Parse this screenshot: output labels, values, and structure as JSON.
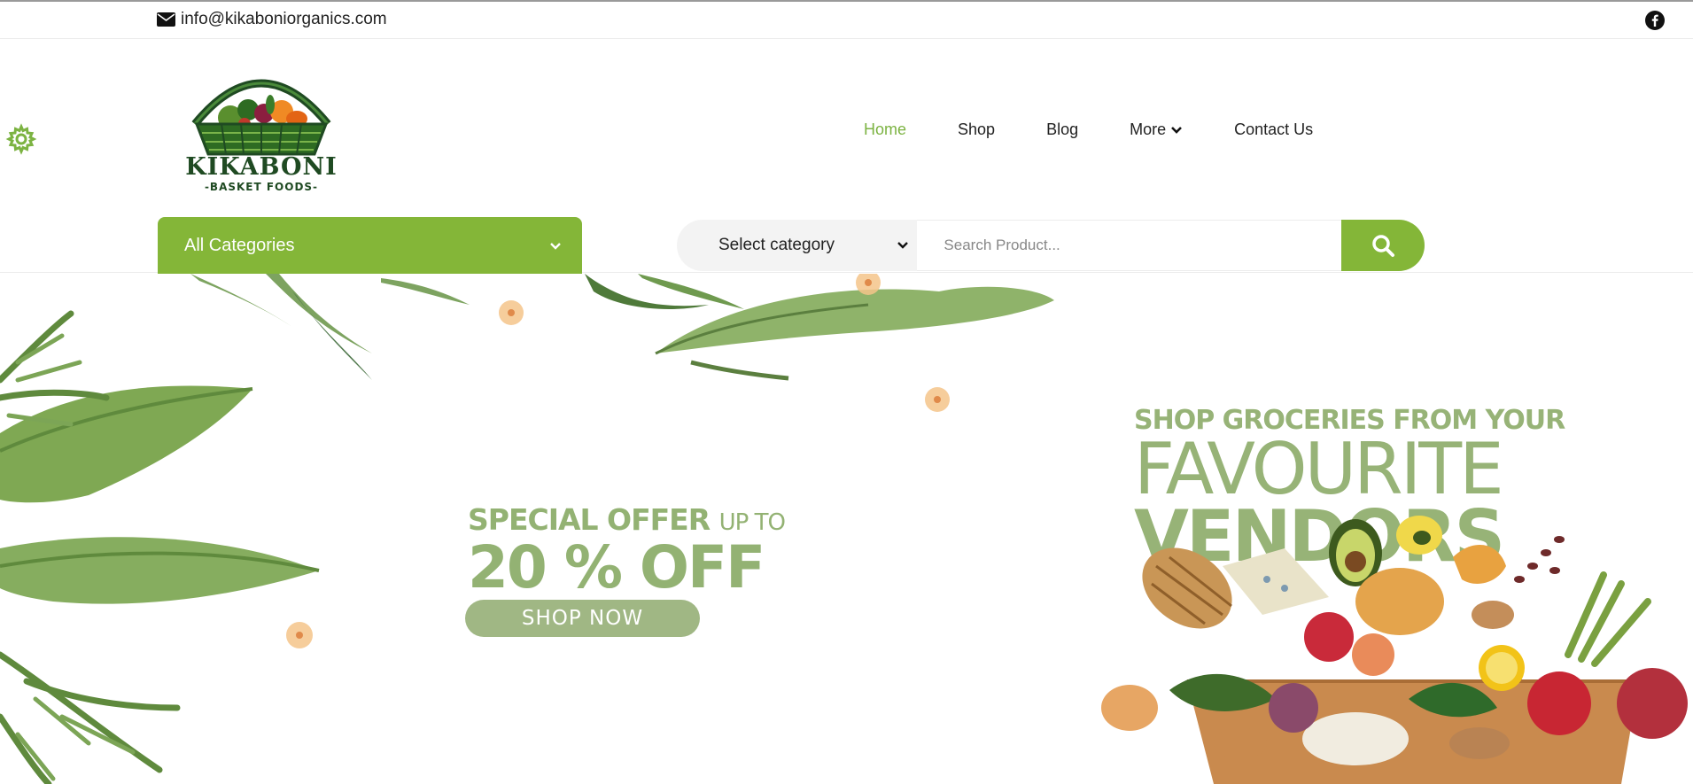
{
  "topbar": {
    "email": "info@kikaboniorganics.com",
    "email_icon": "envelope-icon",
    "social_icon": "facebook-icon"
  },
  "header": {
    "settings_icon": "gear-icon",
    "logo_text": "KIKABONI",
    "logo_subtext": "-BASKET FOODS-",
    "nav": [
      {
        "label": "Home",
        "active": true
      },
      {
        "label": "Shop",
        "active": false
      },
      {
        "label": "Blog",
        "active": false
      },
      {
        "label": "More",
        "active": false,
        "dropdown": true
      },
      {
        "label": "Contact Us",
        "active": false
      }
    ],
    "categories_button": "All Categories",
    "search": {
      "select_value": "Select category",
      "placeholder": "Search Product...",
      "button_icon": "search-icon"
    }
  },
  "hero": {
    "offer_main": "SPECIAL OFFER",
    "offer_small": "UP TO",
    "offer_percent": "20 % OFF",
    "cta": "SHOP NOW",
    "promo_line1": "SHOP GROCERIES FROM YOUR",
    "promo_line2": "FAVOURITE",
    "promo_line3": "VENDORS"
  },
  "colors": {
    "accent": "#84b638",
    "active_nav": "#7cb342",
    "hero_text": "#93b273",
    "logo_dark": "#1f4a22"
  }
}
